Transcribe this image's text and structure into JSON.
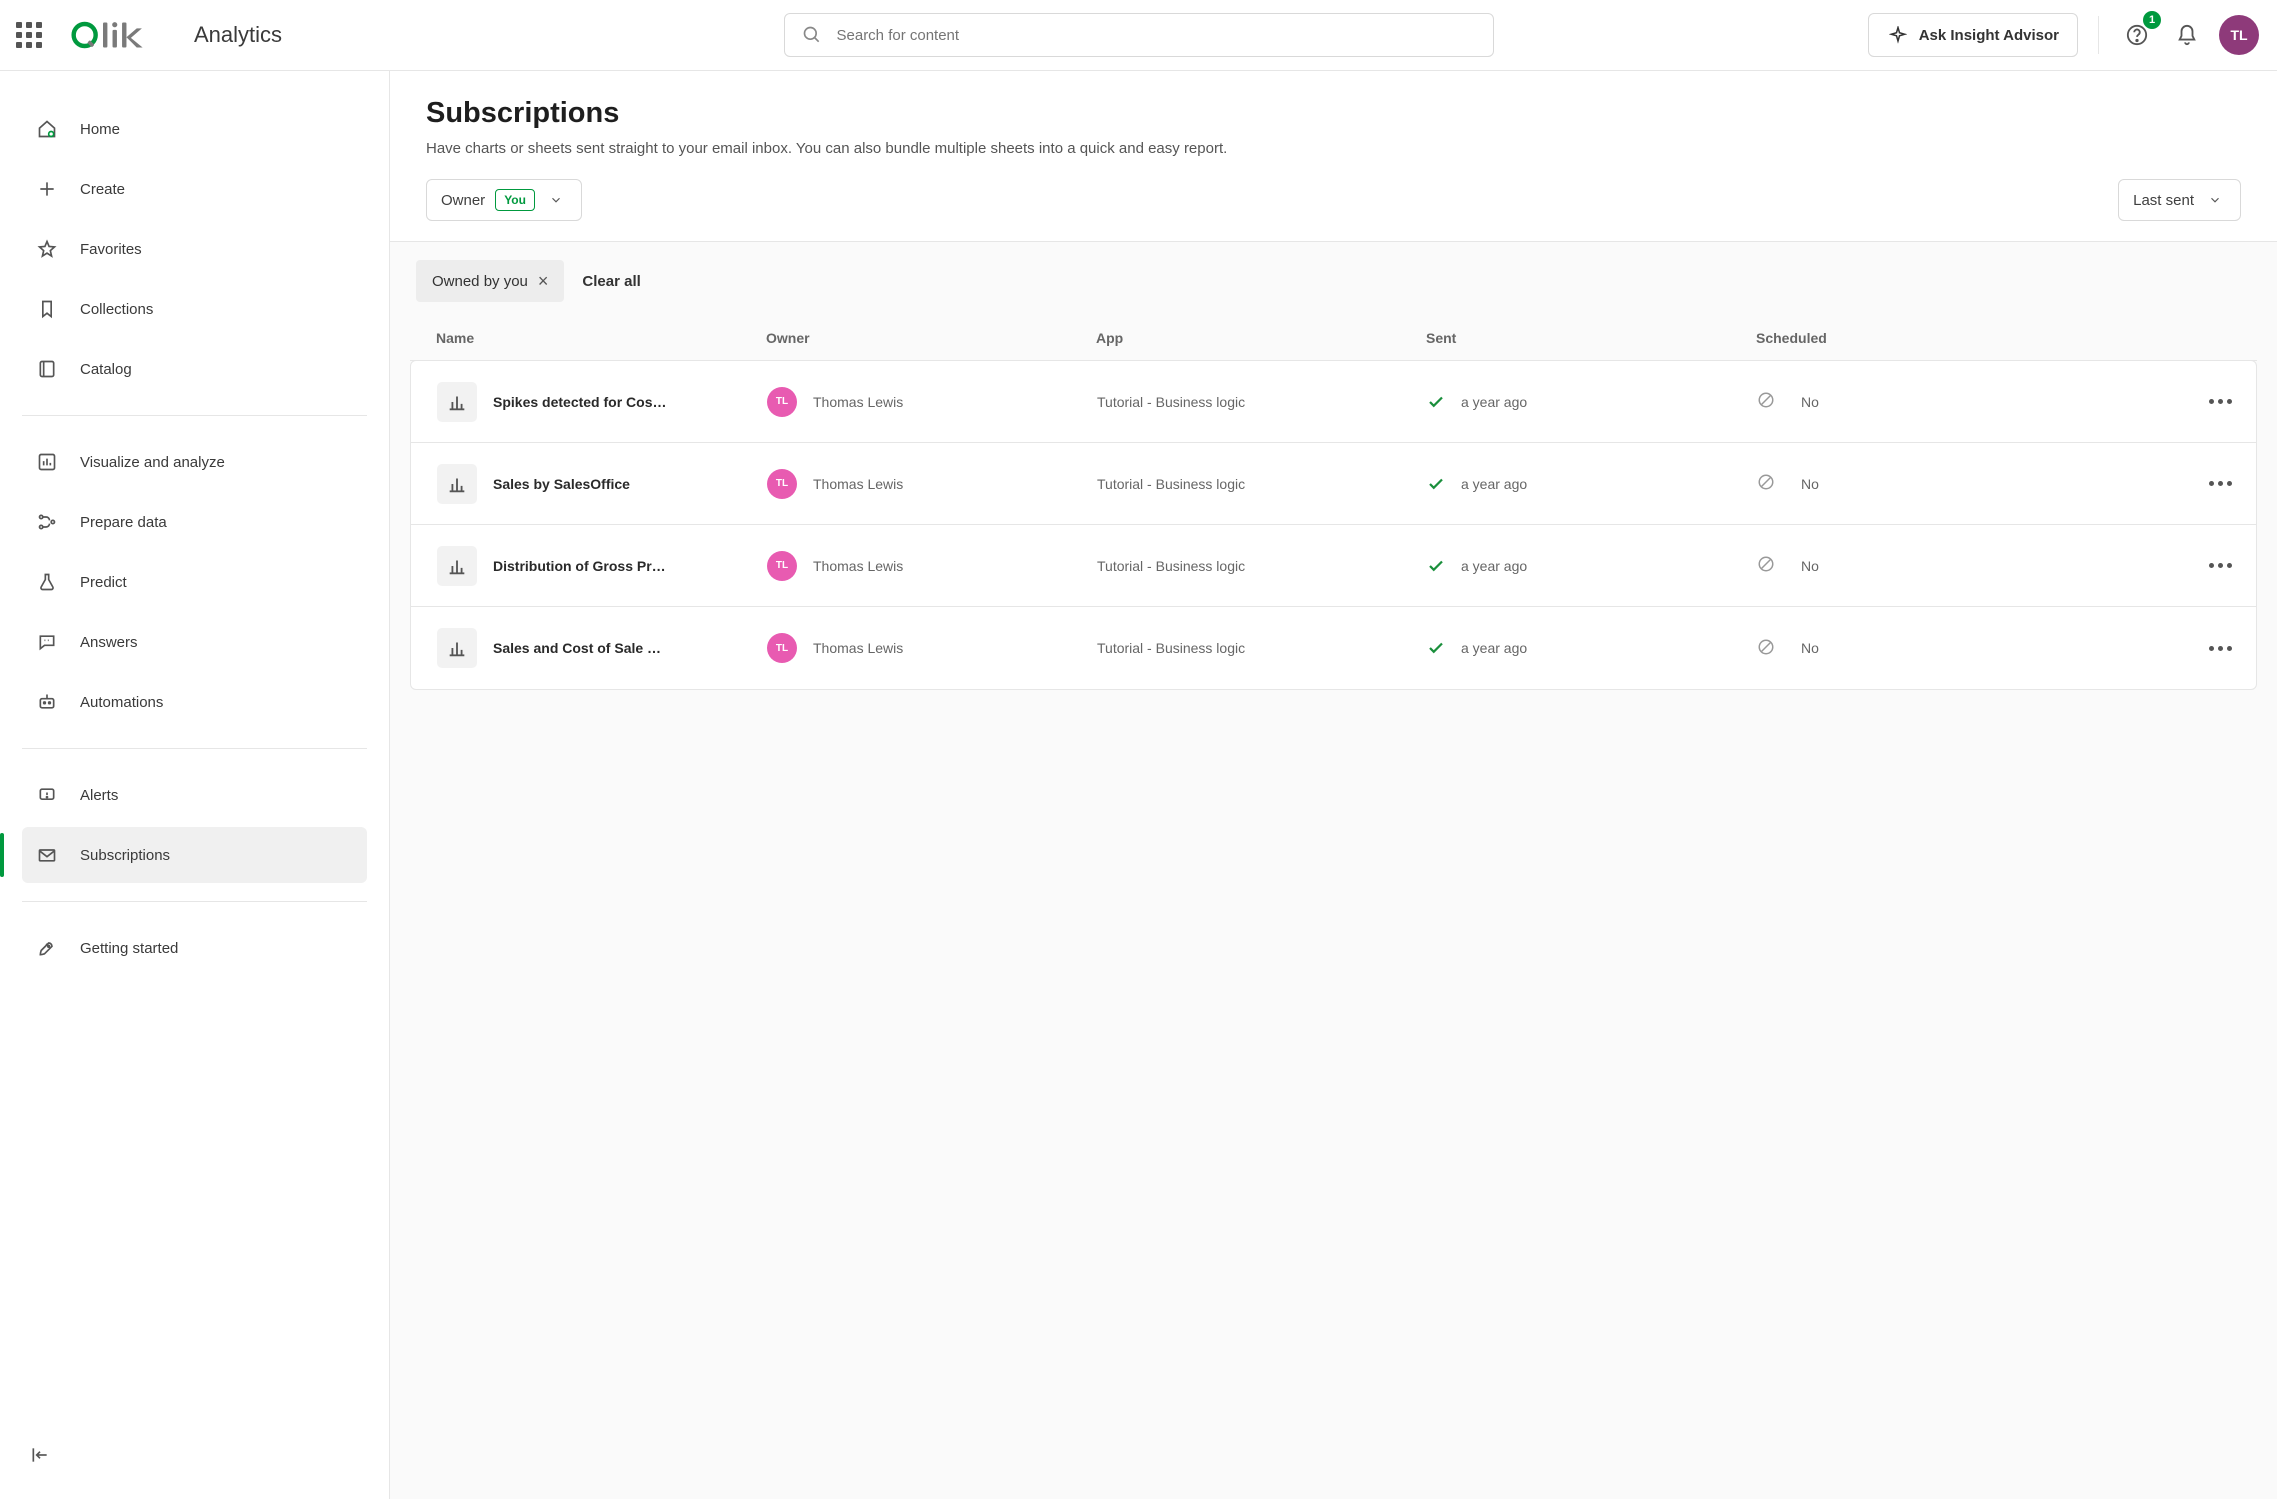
{
  "header": {
    "brand": "Analytics",
    "search_placeholder": "Search for content",
    "ask_label": "Ask Insight Advisor",
    "help_badge": "1",
    "avatar_initials": "TL"
  },
  "sidebar": {
    "groups": [
      {
        "items": [
          {
            "key": "home",
            "label": "Home",
            "icon": "home",
            "active": false
          },
          {
            "key": "create",
            "label": "Create",
            "icon": "plus",
            "active": false
          },
          {
            "key": "favorites",
            "label": "Favorites",
            "icon": "star",
            "active": false
          },
          {
            "key": "collections",
            "label": "Collections",
            "icon": "bookmark",
            "active": false
          },
          {
            "key": "catalog",
            "label": "Catalog",
            "icon": "book",
            "active": false
          }
        ]
      },
      {
        "items": [
          {
            "key": "visualize",
            "label": "Visualize and analyze",
            "icon": "chart",
            "active": false
          },
          {
            "key": "prepare",
            "label": "Prepare data",
            "icon": "flow",
            "active": false
          },
          {
            "key": "predict",
            "label": "Predict",
            "icon": "flask",
            "active": false
          },
          {
            "key": "answers",
            "label": "Answers",
            "icon": "chat",
            "active": false
          },
          {
            "key": "automations",
            "label": "Automations",
            "icon": "robot",
            "active": false
          }
        ]
      },
      {
        "items": [
          {
            "key": "alerts",
            "label": "Alerts",
            "icon": "alert",
            "active": false
          },
          {
            "key": "subscriptions",
            "label": "Subscriptions",
            "icon": "mail",
            "active": true
          }
        ]
      },
      {
        "items": [
          {
            "key": "getting_started",
            "label": "Getting started",
            "icon": "rocket",
            "active": false
          }
        ]
      }
    ]
  },
  "page": {
    "title": "Subscriptions",
    "subtitle": "Have charts or sheets sent straight to your email inbox. You can also bundle multiple sheets into a quick and easy report.",
    "filter_owner_label": "Owner",
    "filter_owner_tag": "You",
    "sort_label": "Last sent",
    "chip_label": "Owned by you",
    "clear_all_label": "Clear all"
  },
  "table": {
    "columns": [
      "Name",
      "Owner",
      "App",
      "Sent",
      "Scheduled"
    ],
    "rows": [
      {
        "name": "Spikes detected for Cos…",
        "owner": "Thomas Lewis",
        "owner_initials": "TL",
        "app": "Tutorial - Business logic",
        "sent": "a year ago",
        "scheduled": "No"
      },
      {
        "name": "Sales by SalesOffice",
        "owner": "Thomas Lewis",
        "owner_initials": "TL",
        "app": "Tutorial - Business logic",
        "sent": "a year ago",
        "scheduled": "No"
      },
      {
        "name": "Distribution of Gross Pr…",
        "owner": "Thomas Lewis",
        "owner_initials": "TL",
        "app": "Tutorial - Business logic",
        "sent": "a year ago",
        "scheduled": "No"
      },
      {
        "name": "Sales and Cost of Sale …",
        "owner": "Thomas Lewis",
        "owner_initials": "TL",
        "app": "Tutorial - Business logic",
        "sent": "a year ago",
        "scheduled": "No"
      }
    ]
  }
}
